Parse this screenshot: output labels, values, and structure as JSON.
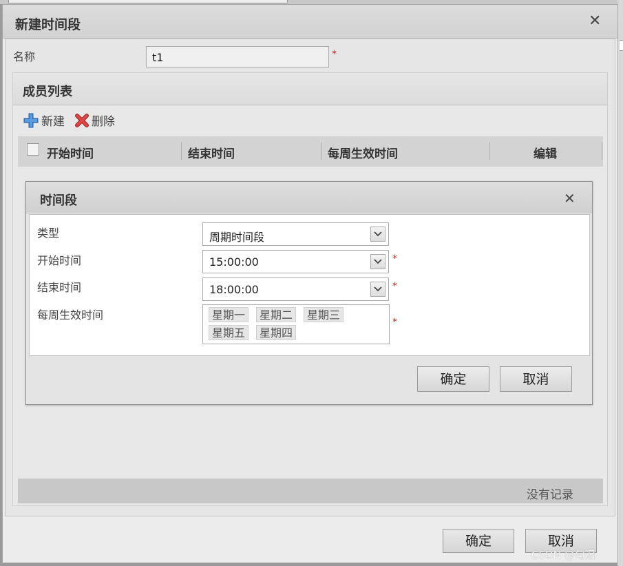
{
  "outer_dialog": {
    "title": "新建时间段",
    "close_icon": "close-icon",
    "name_label": "名称",
    "name_value": "t1",
    "required_mark": "*",
    "ok_label": "确定",
    "cancel_label": "取消"
  },
  "member_panel": {
    "title": "成员列表",
    "new_label": "新建",
    "delete_label": "删除",
    "columns": [
      "开始时间",
      "结束时间",
      "每周生效时间",
      "编辑"
    ],
    "empty_text": "没有记录"
  },
  "inner_dialog": {
    "title": "时间段",
    "type_label": "类型",
    "type_value": "周期时间段",
    "start_label": "开始时间",
    "start_value": "15:00:00",
    "end_label": "结束时间",
    "end_value": "18:00:00",
    "weekday_label": "每周生效时间",
    "weekdays": [
      "星期一",
      "星期二",
      "星期三",
      "星期五",
      "星期四"
    ],
    "ok_label": "确定",
    "cancel_label": "取消"
  },
  "colors": {
    "required": "#e02020",
    "add_icon": "#3a7fd0",
    "delete_icon": "#d03a3a"
  },
  "watermark": "CSDN @勾泪"
}
